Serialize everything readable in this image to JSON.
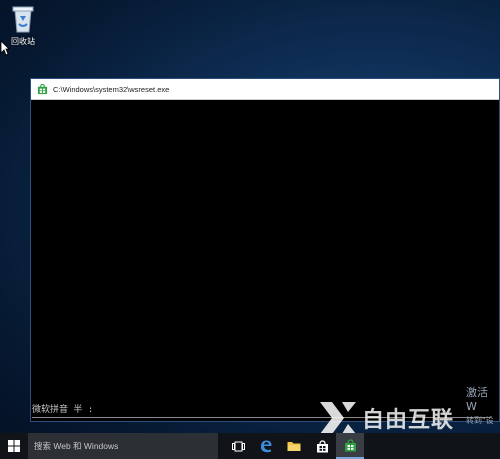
{
  "desktop": {
    "icons": [
      {
        "label": "回收站",
        "icon": "recycle-bin-icon"
      }
    ]
  },
  "console": {
    "title": "C:\\Windows\\system32\\wsreset.exe",
    "ime_status": "微软拼音 半 :"
  },
  "activation": {
    "line1": "激活 W",
    "line2": "转到\"设"
  },
  "watermark": {
    "text": "自由互联"
  },
  "taskbar": {
    "search_placeholder": "搜索 Web 和 Windows",
    "items": [
      {
        "name": "task-view",
        "icon": "task-view-icon",
        "active": false
      },
      {
        "name": "edge",
        "icon": "edge-icon",
        "active": false
      },
      {
        "name": "file-explorer",
        "icon": "folder-icon",
        "active": false
      },
      {
        "name": "store",
        "icon": "store-icon",
        "active": false
      },
      {
        "name": "store-app-running",
        "icon": "store-green-icon",
        "active": true
      }
    ]
  }
}
